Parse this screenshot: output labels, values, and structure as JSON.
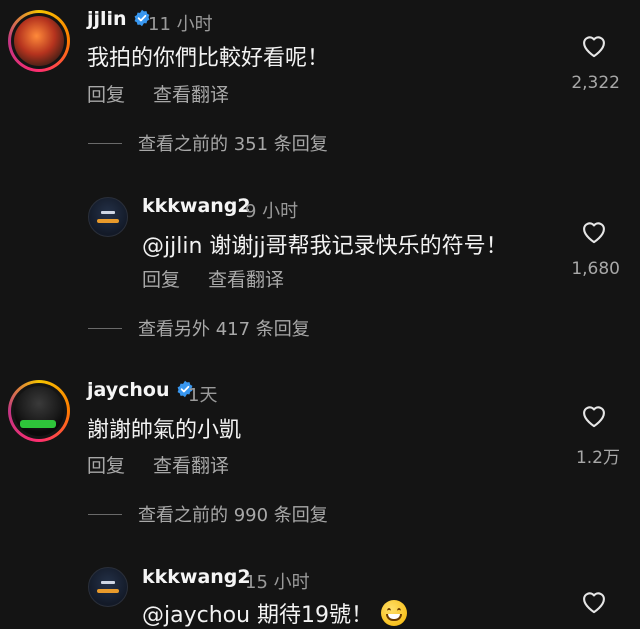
{
  "comments": [
    {
      "username": "jjlin",
      "verified": true,
      "time": "11 小时",
      "text": "我拍的你們比較好看呢！",
      "reply_label": "回复",
      "translate_label": "查看翻译",
      "likes": "2,322",
      "view_replies": "查看之前的 351 条回复",
      "reply": {
        "username": "kkkwang2",
        "time": "9 小时",
        "text": "@jjlin 谢谢jj哥帮我记录快乐的符号！",
        "reply_label": "回复",
        "translate_label": "查看翻译",
        "likes": "1,680",
        "view_replies": "查看另外 417 条回复"
      }
    },
    {
      "username": "jaychou",
      "verified": true,
      "time": "1天",
      "text": "謝謝帥氣的小凱",
      "reply_label": "回复",
      "translate_label": "查看翻译",
      "likes": "1.2万",
      "view_replies": "查看之前的 990 条回复",
      "reply": {
        "username": "kkkwang2",
        "time": "15 小时",
        "text": "@jaychou 期待19號！",
        "emoji": "grinning-face"
      }
    }
  ],
  "colors": {
    "background": "#141414",
    "verified_badge": "#3897f0",
    "secondary_text": "#a8a8a8"
  }
}
